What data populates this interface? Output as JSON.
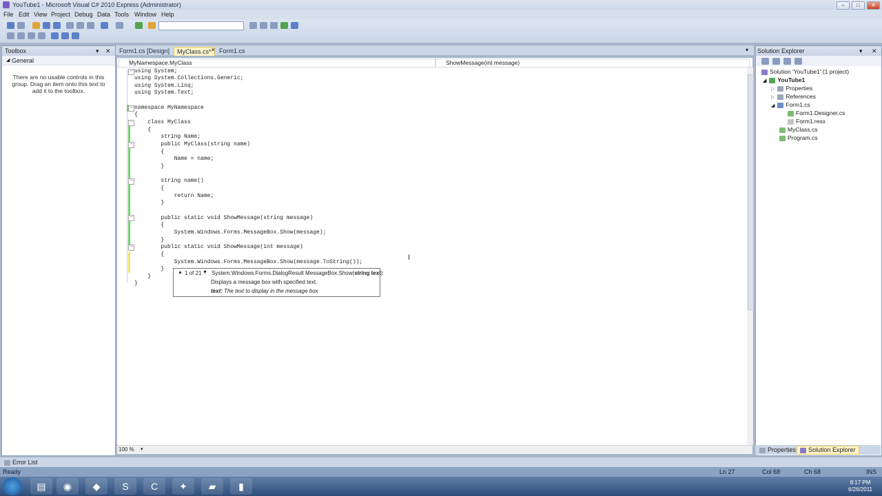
{
  "window": {
    "title": "YouTube1 - Microsoft Visual C# 2010 Express (Administrator)"
  },
  "menu": [
    "File",
    "Edit",
    "View",
    "Project",
    "Debug",
    "Data",
    "Tools",
    "Window",
    "Help"
  ],
  "toolbox": {
    "title": "Toolbox",
    "group": "General",
    "empty_message": "There are no usable controls in this group. Drag an item onto this text to add it to the toolbox."
  },
  "tabs": [
    {
      "label": "Form1.cs [Design]"
    },
    {
      "label": "MyClass.cs*"
    },
    {
      "label": "Form1.cs"
    }
  ],
  "navbar": {
    "type": "MyNamespace.MyClass",
    "member": "ShowMessage(int message)"
  },
  "code": [
    "using System;",
    "using System.Collections.Generic;",
    "using System.Linq;",
    "using System.Text;",
    "",
    "namespace MyNamespace",
    "{",
    "    class MyClass",
    "    {",
    "        string Name;",
    "        public MyClass(string name)",
    "        {",
    "            Name = name;",
    "        }",
    "",
    "        string name()",
    "        {",
    "            return Name;",
    "        }",
    "",
    "        public static void ShowMessage(string message)",
    "        {",
    "            System.Windows.Forms.MessageBox.Show(message);",
    "        }",
    "        public static void ShowMessage(int message)",
    "        {",
    "            System.Windows.Forms.MessageBox.Show(message.ToString());",
    "        }",
    "    }",
    "}"
  ],
  "tooltip": {
    "counter": "1 of 21",
    "signature": "System.Windows.Forms.DialogResult MessageBox.Show(",
    "param": "string text",
    "close_paren": ")",
    "description": "Displays a message box with specified text.",
    "param_name": "text:",
    "param_desc": "The text to display in the message box"
  },
  "zoom": "100 %",
  "solution_explorer": {
    "title": "Solution Explorer",
    "items": [
      {
        "label": "Solution 'YouTube1' (1 project)"
      },
      {
        "label": "YouTube1"
      },
      {
        "label": "Properties"
      },
      {
        "label": "References"
      },
      {
        "label": "Form1.cs"
      },
      {
        "label": "Form1.Designer.cs"
      },
      {
        "label": "Form1.resx"
      },
      {
        "label": "MyClass.cs"
      },
      {
        "label": "Program.cs"
      }
    ],
    "bottom_tabs": [
      "Properties",
      "Solution Explorer"
    ]
  },
  "error_list": "Error List",
  "status": {
    "text": "Ready",
    "ln": "Ln 27",
    "col": "Col 68",
    "ch": "Ch 68",
    "mode": "INS"
  },
  "clock": {
    "time": "8:17 PM",
    "date": "6/26/2011"
  },
  "colors": {
    "keyword": "#1f1fd0",
    "type": "#2b91af",
    "change_saved": "#6fd26b",
    "change_unsaved": "#efe06b"
  }
}
